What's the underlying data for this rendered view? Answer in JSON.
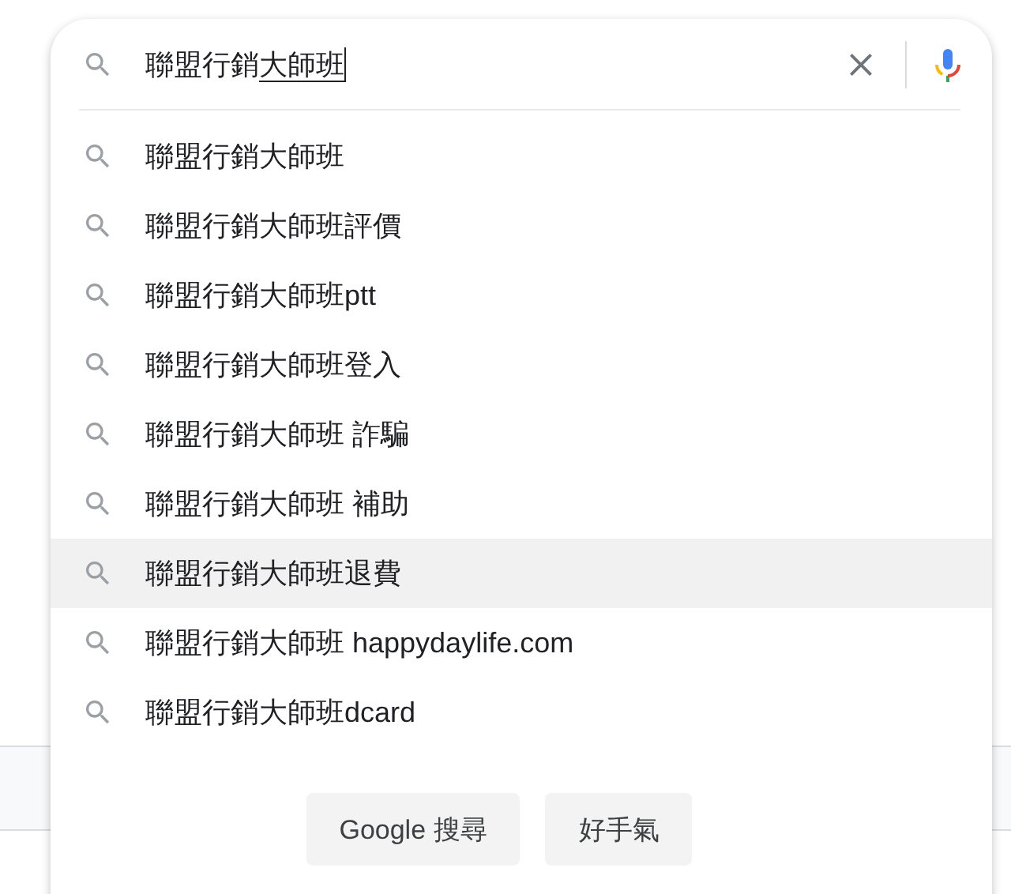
{
  "search": {
    "query": "聯盟行銷",
    "composing": "大師班"
  },
  "suggestions": [
    {
      "text": "聯盟行銷大師班",
      "selected": false
    },
    {
      "text": "聯盟行銷大師班評價",
      "selected": false
    },
    {
      "text": "聯盟行銷大師班ptt",
      "selected": false
    },
    {
      "text": "聯盟行銷大師班登入",
      "selected": false
    },
    {
      "text": "聯盟行銷大師班 詐騙",
      "selected": false
    },
    {
      "text": "聯盟行銷大師班 補助",
      "selected": false
    },
    {
      "text": "聯盟行銷大師班退費",
      "selected": true
    },
    {
      "text": "聯盟行銷大師班 happydaylife.com",
      "selected": false
    },
    {
      "text": "聯盟行銷大師班dcard",
      "selected": false
    }
  ],
  "buttons": [
    "Google 搜尋",
    "好手氣"
  ]
}
